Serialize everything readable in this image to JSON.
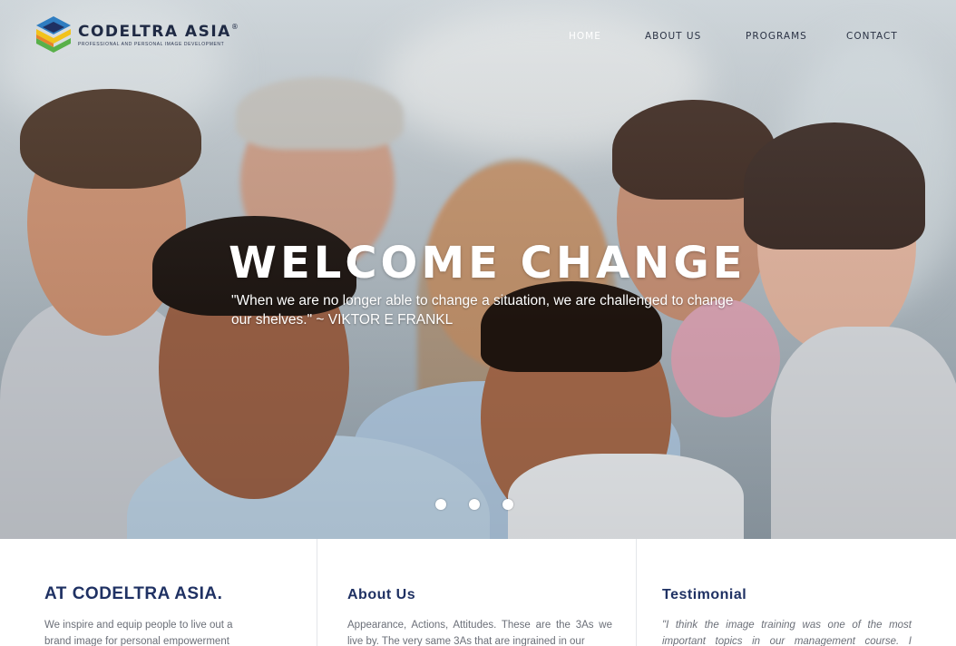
{
  "brand": {
    "name": "CODELTRA ASIA",
    "registered": "®",
    "tagline": "PROFESSIONAL AND PERSONAL IMAGE DEVELOPMENT",
    "colors": {
      "navy": "#1f3163",
      "yellow": "#f2c21b",
      "green": "#59b04a",
      "blue": "#2f7dc1",
      "orange": "#e8832a"
    }
  },
  "nav": {
    "items": [
      {
        "label": "HOME",
        "active": true
      },
      {
        "label": "ABOUT US",
        "active": false
      },
      {
        "label": "PROGRAMS",
        "active": false
      },
      {
        "label": "CONTACT",
        "active": false
      }
    ]
  },
  "hero": {
    "title": "WELCOME CHANGE",
    "quote": "\"When we are no longer able to change a situation, we are challenged to change our shelves.\" ~ VIKTOR E FRANKL",
    "slides": 3
  },
  "columns": [
    {
      "title": "AT CODELTRA ASIA.",
      "text": "We inspire and equip people to live out a brand image for personal empowerment"
    },
    {
      "title": "About Us",
      "text": "Appearance, Actions, Attitudes. These are the 3As we live by. The very same 3As that are ingrained in our"
    },
    {
      "title": "Testimonial",
      "text": "\"I think the image training was one of the most important topics in our management course. I returned"
    }
  ]
}
